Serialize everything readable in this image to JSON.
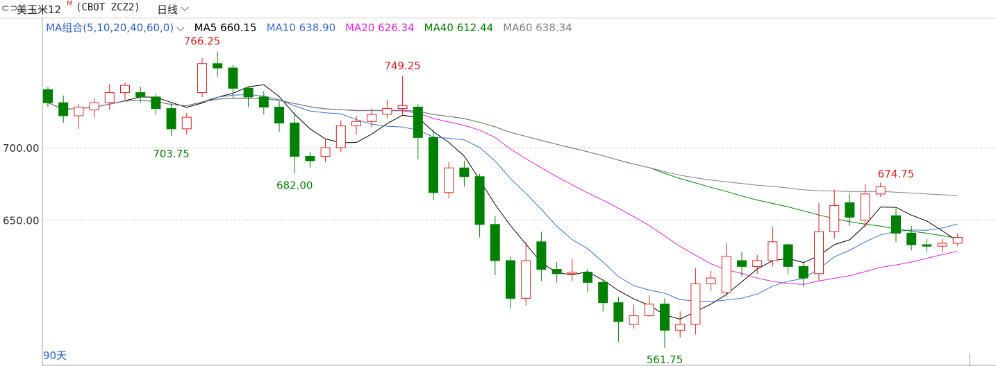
{
  "header": {
    "title": "美玉米12",
    "title_sup": "M",
    "symbol": "(CBOT ZCZ2)",
    "period": "日线",
    "period_arrow": "⌵"
  },
  "ma_legend": {
    "group_label": "MA组合(5,10,20,40,60,0)",
    "group_arrow": "⌵",
    "items": [
      {
        "label": "MA5",
        "value": "660.15",
        "color": "#000000"
      },
      {
        "label": "MA10",
        "value": "638.90",
        "color": "#3a6fd8"
      },
      {
        "label": "MA20",
        "value": "626.34",
        "color": "#e020e0"
      },
      {
        "label": "MA40",
        "value": "612.44",
        "color": "#008000"
      },
      {
        "label": "MA60",
        "value": "638.34",
        "color": "#808080"
      }
    ]
  },
  "footer": {
    "days_label": "90天"
  },
  "colors": {
    "up": "#e02020",
    "down": "#008000",
    "grid": "#c8c8c8",
    "text_axis": "#333333",
    "legend_label": "#2a5fd0"
  },
  "chart_data": {
    "type": "candlestick",
    "y_ticks": [
      700,
      650
    ],
    "y_tick_labels": [
      "700.00",
      "650.00"
    ],
    "ylim": [
      555,
      790
    ],
    "annotations": [
      {
        "text": "766.25",
        "value": 766.25,
        "index": 10,
        "color": "#e02020"
      },
      {
        "text": "749.25",
        "value": 749.25,
        "index": 23,
        "color": "#e02020"
      },
      {
        "text": "703.75",
        "value": 703.75,
        "index": 8,
        "color": "#008000"
      },
      {
        "text": "682.00",
        "value": 682.0,
        "index": 16,
        "color": "#008000"
      },
      {
        "text": "561.75",
        "value": 561.75,
        "index": 40,
        "color": "#008000"
      },
      {
        "text": "674.75",
        "value": 674.75,
        "index": 55,
        "color": "#e02020"
      }
    ],
    "candles": [
      [
        740,
        731,
        742,
        728
      ],
      [
        731,
        722,
        736,
        717
      ],
      [
        722,
        728,
        730,
        713
      ],
      [
        726,
        731,
        734,
        721
      ],
      [
        731,
        738,
        744,
        726
      ],
      [
        738,
        743,
        745,
        733
      ],
      [
        738,
        735,
        742,
        731
      ],
      [
        735,
        727,
        737,
        723
      ],
      [
        727,
        713,
        731,
        708
      ],
      [
        713,
        721,
        724,
        709
      ],
      [
        738,
        758,
        762,
        735
      ],
      [
        758,
        755,
        766.25,
        749
      ],
      [
        755,
        741,
        757,
        734
      ],
      [
        741,
        735,
        742,
        728
      ],
      [
        735,
        728,
        739,
        723
      ],
      [
        728,
        717,
        732,
        711
      ],
      [
        717,
        694,
        724,
        682
      ],
      [
        694,
        691,
        697,
        686
      ],
      [
        694,
        700,
        706,
        690
      ],
      [
        700,
        715,
        719,
        697
      ],
      [
        715,
        718,
        722,
        709
      ],
      [
        718,
        723,
        727,
        714
      ],
      [
        723,
        727,
        733,
        720
      ],
      [
        727,
        729,
        749.25,
        722
      ],
      [
        728,
        707,
        730,
        692
      ],
      [
        707,
        669,
        712,
        664
      ],
      [
        669,
        686,
        690,
        665
      ],
      [
        686,
        680,
        691,
        673
      ],
      [
        680,
        647,
        682,
        638
      ],
      [
        647,
        622,
        653,
        612
      ],
      [
        622,
        596,
        625,
        589
      ],
      [
        596,
        622,
        635,
        591
      ],
      [
        635,
        616,
        642,
        608
      ],
      [
        616,
        613,
        621,
        607
      ],
      [
        613,
        614,
        623,
        608
      ],
      [
        614,
        607,
        616,
        600
      ],
      [
        607,
        593,
        609,
        587
      ],
      [
        593,
        580,
        597,
        566
      ],
      [
        578,
        584,
        592,
        575
      ],
      [
        584,
        592,
        598,
        583
      ],
      [
        592,
        574,
        596,
        561.75
      ],
      [
        574,
        578,
        587,
        569
      ],
      [
        578,
        606,
        617,
        571
      ],
      [
        606,
        610,
        615,
        601
      ],
      [
        600,
        625,
        634,
        597
      ],
      [
        622,
        618,
        628,
        611
      ],
      [
        618,
        622,
        626,
        613
      ],
      [
        622,
        635,
        645,
        618
      ],
      [
        633,
        618,
        634,
        613
      ],
      [
        618,
        610,
        622,
        604
      ],
      [
        613,
        642,
        662,
        608
      ],
      [
        642,
        660,
        671,
        637
      ],
      [
        662,
        652,
        668,
        646
      ],
      [
        650,
        668,
        675,
        645
      ],
      [
        668,
        673,
        676,
        666
      ],
      [
        653,
        641,
        658,
        635
      ],
      [
        641,
        633,
        646,
        629
      ],
      [
        633,
        632,
        637,
        628
      ],
      [
        632,
        634,
        637,
        628
      ],
      [
        634,
        638,
        641,
        632
      ]
    ]
  }
}
